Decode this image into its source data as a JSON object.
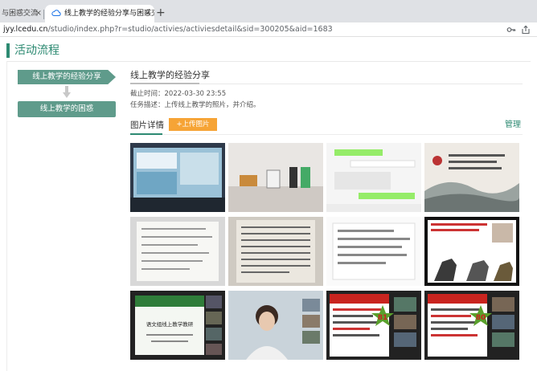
{
  "browser": {
    "tabs": [
      {
        "label": "与困惑交流",
        "active": false
      },
      {
        "label": "线上教学的经验分享与困惑交流",
        "active": true
      }
    ],
    "close_glyph": "×",
    "new_tab_glyph": "+",
    "url_host": "jyy.lcedu.cn",
    "url_path": "/studio/index.php?r=studio/activies/activiesdetail&sid=300205&aid=1683",
    "address_icons": [
      "key-icon",
      "share-icon"
    ]
  },
  "page": {
    "title": "活动流程",
    "steps": [
      {
        "label": "线上教学的经验分享",
        "active": true
      },
      {
        "label": "线上教学的困惑",
        "active": false
      }
    ],
    "current_step": {
      "title": "线上教学的经验分享",
      "deadline": "截止时间：2022-03-30 23:55",
      "description": "任务描述：上传线上教学的照片，并介绍。"
    },
    "gallery": {
      "section_label": "图片详情",
      "upload_label": "+上传图片",
      "manage_label": "管理"
    }
  },
  "photos": {
    "row1": [
      "p1",
      "p2",
      "p3",
      "p4"
    ],
    "row2": [
      "p5",
      "p6",
      "p7",
      "p8"
    ],
    "row3": [
      "p9",
      "p10",
      "p11",
      "p12"
    ],
    "captions": {
      "p9_banner": "语文组线上教学教研",
      "p11_score": "81",
      "p12_score": "80"
    }
  },
  "colors": {
    "accent": "#2d8a72",
    "step": "#5f9b8b",
    "upload": "#f6a436"
  }
}
